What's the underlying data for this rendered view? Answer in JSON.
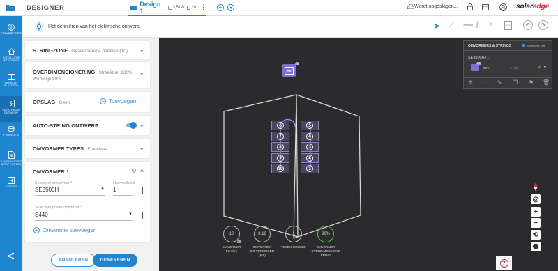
{
  "app": {
    "title": "DESIGNER",
    "logo_part1": "solar",
    "logo_part2": "edge"
  },
  "tab": {
    "name": "Design 1",
    "power": "3,5kW",
    "count": "10"
  },
  "status": "Wordt opgeslagen...",
  "rail": [
    {
      "label": "PROJECT INFO"
    },
    {
      "label": "INSTALLATIE INTEKENEN"
    },
    {
      "label": "PANELEN PLAATSEN"
    },
    {
      "label": "ELEKTRISCH ONTWERP"
    },
    {
      "label": "FINANCIEN"
    },
    {
      "label": "SAMENVATTING & RAPPORTEN"
    },
    {
      "label": "EXPORT"
    }
  ],
  "info": {
    "text": "Het definiëren van het elektrische ontwerp."
  },
  "cards": {
    "stringzone": {
      "title": "STRINGZONE",
      "sub": "Geselecteerde panelen (10)"
    },
    "overdim": {
      "title": "OVERDIMENSIONERING",
      "sub": "Streefdoel 130%",
      "sub2": "Werkelijk 90%"
    },
    "opslag": {
      "title": "OPSLAG",
      "sub": "Geen",
      "add": "Toevoegen"
    },
    "autostring": {
      "title": "AUTO-STRING ONTWERP"
    },
    "types": {
      "title": "OMVORMER TYPES",
      "sub": "Enkelfase"
    },
    "omvormer": {
      "title": "OMVORMER 1",
      "label1": "Selecteer omvormer *",
      "value1": "SE3500H",
      "label2": "Hoeveelheid",
      "value2": "1",
      "label3": "Selecteer power optimizer *",
      "value3": "S440",
      "add": "Omvormer toevoegen"
    }
  },
  "buttons": {
    "cancel": "ANNULEREN",
    "generate": "GENEREREN"
  },
  "strings_panel": {
    "title": "OMVORMERS & STRINGS",
    "select_all": "Selecteer alle",
    "inverter": "SE3500H (1)",
    "badge": "1/1",
    "percent": "90%",
    "ratio": "1 / 0/1"
  },
  "roof_badge": {
    "count": "10",
    "sub": "10"
  },
  "modules_left": [
    "6",
    "7",
    "8",
    "9",
    "10"
  ],
  "modules_right": [
    "5",
    "4",
    "3",
    "2",
    "1"
  ],
  "gauges": [
    {
      "value": "10",
      "sub": "10",
      "label": "OMVORMER\nPanelen",
      "ring": "#bbbbbb",
      "level": 1.0
    },
    {
      "value": "3,16",
      "label": "OMVORMER\nDC VERMOGEN\n(kW)",
      "ring": "#bbbbbb",
      "level": 1.0
    },
    {
      "value": "1",
      "label": "TEKENREEKSEN",
      "ring": "#bbbbbb",
      "level": 1.0
    },
    {
      "value": "90%",
      "label": "OMVORMER\nOVERDIMENSIONE\nERING",
      "ring": "#56c13a",
      "level": 0.9
    }
  ],
  "colors": {
    "brand": "#1f85d0",
    "accent": "#3a8dde",
    "string": "#9b8cf0",
    "canvas": "#2b2b2d",
    "ok": "#56c13a",
    "logo_red": "#e4222a"
  }
}
